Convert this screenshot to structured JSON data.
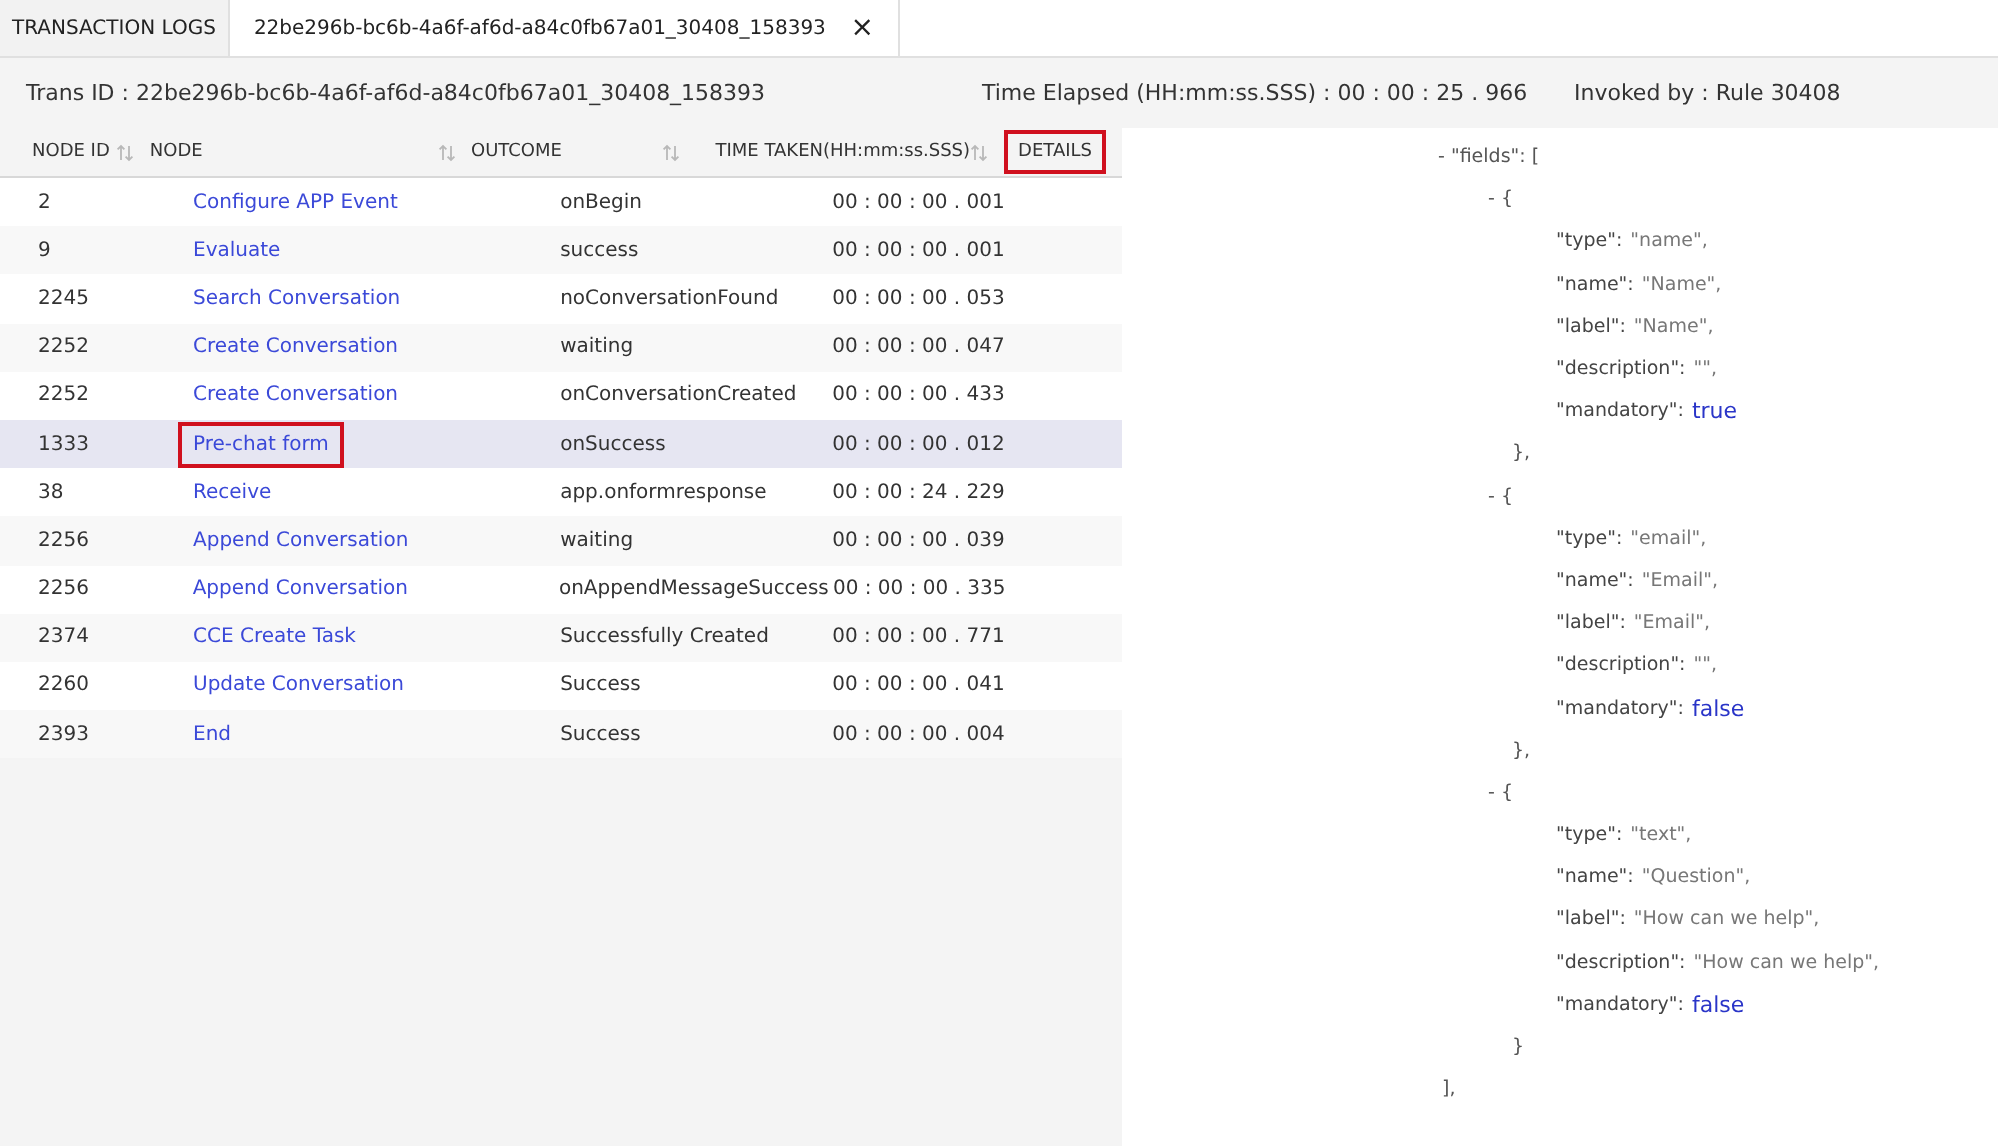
{
  "tabs": [
    {
      "label": "TRANSACTION LOGS",
      "selected": false
    },
    {
      "label": "22be296b-bc6b-4a6f-af6d-a84c0fb67a01_30408_158393",
      "selected": true,
      "close": "×"
    }
  ],
  "info": {
    "trans_id": "Trans ID : 22be296b-bc6b-4a6f-af6d-a84c0fb67a01_30408_158393",
    "time_elapsed": "Time Elapsed (HH:mm:ss.SSS) :  00 : 00 : 25 . 966",
    "invoked_by": "Invoked by : Rule 30408"
  },
  "table": {
    "columns": [
      {
        "label": "NODE ID",
        "sortable": true,
        "highlighted": false
      },
      {
        "label": "NODE",
        "sortable": true,
        "highlighted": false
      },
      {
        "label": "OUTCOME",
        "sortable": true,
        "highlighted": false
      },
      {
        "label": "TIME TAKEN(HH:mm:ss.SSS)",
        "sortable": true,
        "highlighted": false
      },
      {
        "label": "DETAILS",
        "sortable": false,
        "highlighted": true
      }
    ],
    "rows": [
      {
        "node_id": "2",
        "node": "Configure APP Event",
        "outcome": "onBegin",
        "time": "00 : 00 : 00 . 001",
        "selected": false,
        "highlighted": false
      },
      {
        "node_id": "9",
        "node": "Evaluate",
        "outcome": "success",
        "time": "00 : 00 : 00 . 001",
        "selected": false,
        "highlighted": false
      },
      {
        "node_id": "2245",
        "node": "Search Conversation",
        "outcome": "noConversationFound",
        "time": "00 : 00 : 00 . 053",
        "selected": false,
        "highlighted": false
      },
      {
        "node_id": "2252",
        "node": "Create Conversation",
        "outcome": "waiting",
        "time": "00 : 00 : 00 . 047",
        "selected": false,
        "highlighted": false
      },
      {
        "node_id": "2252",
        "node": "Create Conversation",
        "outcome": "onConversationCreated",
        "time": "00 : 00 : 00 . 433",
        "selected": false,
        "highlighted": false
      },
      {
        "node_id": "1333",
        "node": "Pre-chat form",
        "outcome": "onSuccess",
        "time": "00 : 00 : 00 . 012",
        "selected": true,
        "highlighted": true
      },
      {
        "node_id": "38",
        "node": "Receive",
        "outcome": "app.onformresponse",
        "time": "00 : 00 : 24 . 229",
        "selected": false,
        "highlighted": false
      },
      {
        "node_id": "2256",
        "node": "Append Conversation",
        "outcome": "waiting",
        "time": "00 : 00 : 00 . 039",
        "selected": false,
        "highlighted": false
      },
      {
        "node_id": "2256",
        "node": "Append Conversation",
        "outcome": "onAppendMessageSuccess",
        "time": "00 : 00 : 00 . 335",
        "selected": false,
        "highlighted": false
      },
      {
        "node_id": "2374",
        "node": "CCE Create Task",
        "outcome": "Successfully Created",
        "time": "00 : 00 : 00 . 771",
        "selected": false,
        "highlighted": false
      },
      {
        "node_id": "2260",
        "node": "Update Conversation",
        "outcome": "Success",
        "time": "00 : 00 : 00 . 041",
        "selected": false,
        "highlighted": false
      },
      {
        "node_id": "2393",
        "node": "End",
        "outcome": "Success",
        "time": "00 : 00 : 00 . 004",
        "selected": false,
        "highlighted": false
      }
    ]
  },
  "details": {
    "open": "- \"fields\": [",
    "close": "],",
    "children": [
      {
        "open": "- {",
        "close": "},",
        "children": [
          {
            "key": "\"type\":",
            "value": "\"name\",",
            "kind": "string"
          },
          {
            "key": "\"name\":",
            "value": "\"Name\",",
            "kind": "string"
          },
          {
            "key": "\"label\":",
            "value": "\"Name\",",
            "kind": "string"
          },
          {
            "key": "\"description\":",
            "value": "\"\",",
            "kind": "string"
          },
          {
            "key": "\"mandatory\":",
            "value": "true",
            "kind": "boolean"
          }
        ]
      },
      {
        "open": "- {",
        "close": "},",
        "children": [
          {
            "key": "\"type\":",
            "value": "\"email\",",
            "kind": "string"
          },
          {
            "key": "\"name\":",
            "value": "\"Email\",",
            "kind": "string"
          },
          {
            "key": "\"label\":",
            "value": "\"Email\",",
            "kind": "string"
          },
          {
            "key": "\"description\":",
            "value": "\"\",",
            "kind": "string"
          },
          {
            "key": "\"mandatory\":",
            "value": "false",
            "kind": "boolean"
          }
        ]
      },
      {
        "open": "- {",
        "close": "}",
        "children": [
          {
            "key": "\"type\":",
            "value": "\"text\",",
            "kind": "string"
          },
          {
            "key": "\"name\":",
            "value": "\"Question\",",
            "kind": "string"
          },
          {
            "key": "\"label\":",
            "value": "\"How can we help\",",
            "kind": "string"
          },
          {
            "key": "\"description\":",
            "value": "\"How can we help\",",
            "kind": "string"
          },
          {
            "key": "\"mandatory\":",
            "value": "false",
            "kind": "boolean"
          }
        ]
      }
    ]
  }
}
